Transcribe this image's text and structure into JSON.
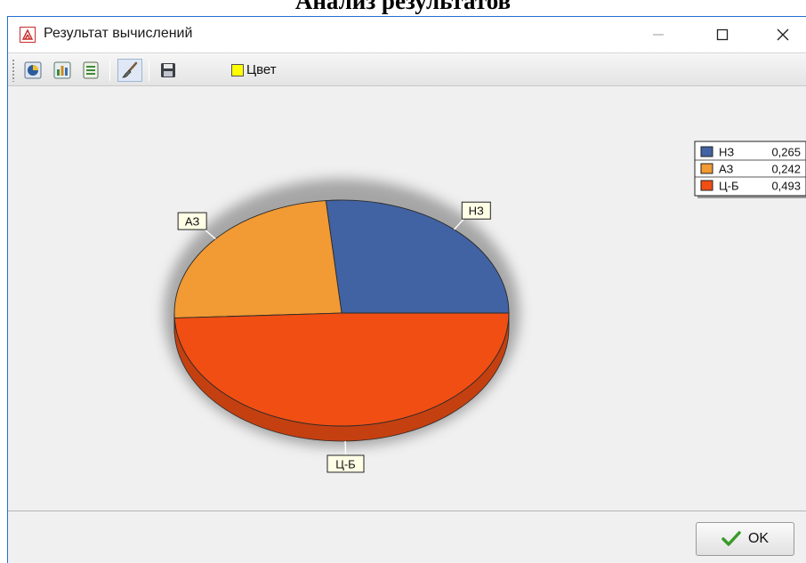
{
  "document": {
    "heading": "Анализ результатов"
  },
  "window": {
    "title": "Результат вычислений",
    "controls": {
      "minimize": "—",
      "maximize": "☐",
      "close": "✕"
    }
  },
  "toolbar": {
    "buttons": [
      {
        "icon": "pie-chart-view-icon"
      },
      {
        "icon": "bar-chart-view-icon"
      },
      {
        "icon": "list-view-icon"
      },
      {
        "icon": "brush-icon",
        "pressed": true
      },
      {
        "icon": "save-icon"
      }
    ],
    "color_label": "Цвет",
    "color_swatch": "#ffff00"
  },
  "chart_data": {
    "type": "pie",
    "title": "",
    "labels": [
      "НЗ",
      "АЗ",
      "Ц-Б"
    ],
    "values": [
      0.265,
      0.242,
      0.493
    ],
    "value_labels": [
      "0,265",
      "0,242",
      "0,493"
    ],
    "colors": [
      "#4163a3",
      "#f29a33",
      "#f04e13"
    ],
    "three_d": true,
    "legend": "top-right"
  },
  "footer": {
    "ok_label": "OK"
  }
}
